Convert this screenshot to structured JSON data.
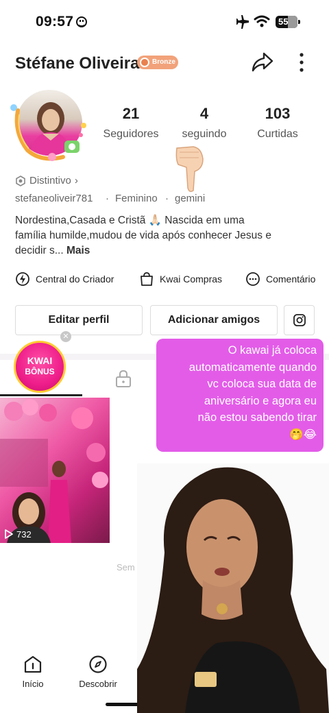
{
  "status_bar": {
    "time": "09:57",
    "battery": "55"
  },
  "header": {
    "name": "Stéfane Oliveira",
    "badge": "Bronze",
    "share_icon": "share-arrow-icon",
    "more_icon": "more-vertical-icon"
  },
  "stats": [
    {
      "value": "21",
      "label": "Seguidores"
    },
    {
      "value": "4",
      "label": "seguindo"
    },
    {
      "value": "103",
      "label": "Curtidas"
    }
  ],
  "distinctive_label": "Distintivo",
  "username": "stefaneoliveir781",
  "gender": "Feminino",
  "sign": "gemini",
  "bio_line1": "Nordestina,Casada e Cristã 🙏🏻 Nascida em uma",
  "bio_line2": "família humilde,mudou de vida após conhecer Jesus e",
  "bio_line3": "decidir s...",
  "bio_more": "Mais",
  "shortcuts": [
    {
      "icon": "creator-center-icon",
      "label": "Central do Criador"
    },
    {
      "icon": "shopping-bag-icon",
      "label": "Kwai Compras"
    },
    {
      "icon": "comment-icon",
      "label": "Comentário"
    }
  ],
  "buttons": {
    "edit": "Editar perfil",
    "add_friends": "Adicionar amigos"
  },
  "kwai_bonus": {
    "line1": "KWAI",
    "line2": "BÔNUS"
  },
  "video": {
    "views": "732"
  },
  "overlay_note": {
    "line1": "O kawai já coloca",
    "line2": "automaticamente quando",
    "line3": "vc coloca sua data de",
    "line4": "aniversário e agora eu",
    "line5": "não estou sabendo tirar",
    "line6": "🤭😂"
  },
  "empty_text": "Sem mais",
  "bottom_nav": [
    {
      "icon": "home-icon",
      "label": "Início"
    },
    {
      "icon": "compass-icon",
      "label": "Descobrir"
    }
  ],
  "colors": {
    "accent_pink": "#e35ce8",
    "badge_bronze": "#f2a27a",
    "bonus_pink": "#ee1d8a"
  }
}
